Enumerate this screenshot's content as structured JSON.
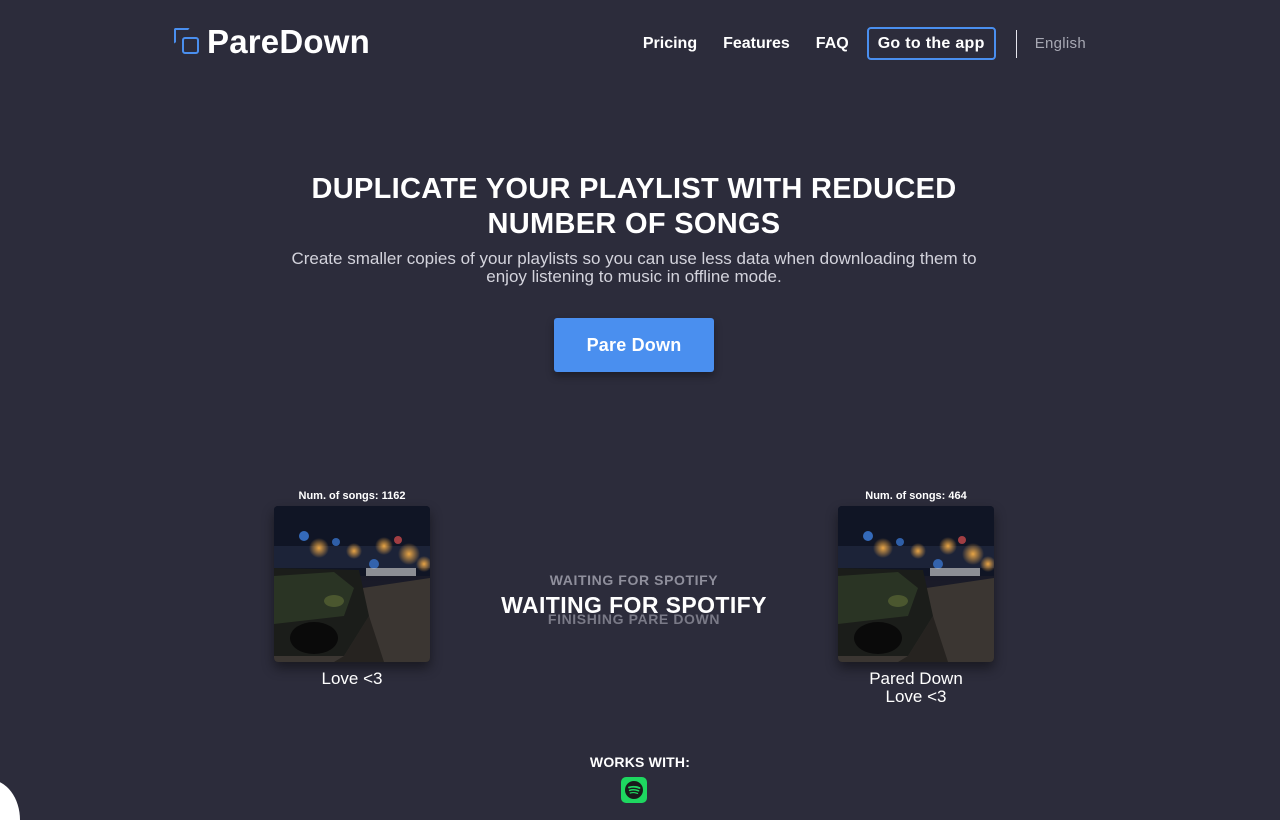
{
  "brand": {
    "name": "PareDown",
    "accent": "#4a8fef"
  },
  "nav": {
    "links": [
      "Pricing",
      "Features",
      "FAQ"
    ],
    "cta": "Go to the app",
    "language": "English"
  },
  "hero": {
    "title_line1": "DUPLICATE YOUR PLAYLIST WITH REDUCED",
    "title_line2": "NUMBER OF SONGS",
    "subtitle_line1": "Create smaller copies of your playlists so you can use less data when downloading them to",
    "subtitle_line2": "enjoy listening to music in offline mode.",
    "button": "Pare Down"
  },
  "demo": {
    "source": {
      "count_label": "Num. of songs: 1162",
      "name": "Love <3"
    },
    "result": {
      "count_label": "Num. of songs: 464",
      "name_line1": "Pared Down",
      "name_line2": "Love <3"
    },
    "status_prev": "WAITING FOR SPOTIFY",
    "status_current": "WAITING FOR SPOTIFY",
    "status_next": "FINISHING PARE DOWN"
  },
  "footer": {
    "works_with": "WORKS WITH:",
    "service_icon": "spotify-icon"
  },
  "colors": {
    "background": "#2c2c3b",
    "spotify": "#1ed760"
  }
}
